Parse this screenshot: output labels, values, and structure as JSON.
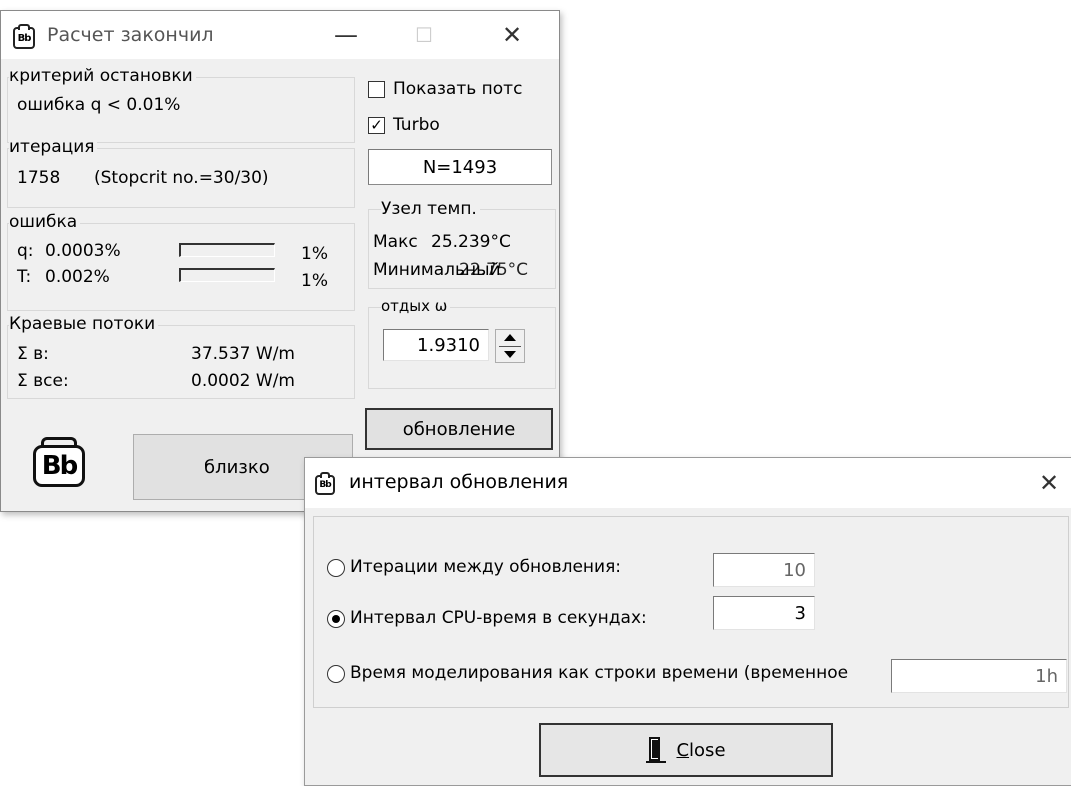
{
  "main": {
    "title": "Расчет закончил",
    "minimize_glyph": "—",
    "maximize_glyph": "☐",
    "close_glyph": "✕",
    "stop_criterion": {
      "label": "критерий остановки",
      "value": "ошибка q < 0.01%"
    },
    "iteration": {
      "label": "итерация",
      "value": "1758",
      "stopcrit": "(Stopcrit no.=30/30)"
    },
    "error": {
      "label": "ошибка",
      "q_label": "q:",
      "q_value": "0.0003%",
      "q_bar_fraction": 0.0,
      "q_max": "1%",
      "t_label": "T:",
      "t_value": "0.002%",
      "t_bar_fraction": 0.0,
      "t_max": "1%"
    },
    "boundary": {
      "label": "Краевые потоки",
      "in_label": "Σ в:",
      "in_value": "37.537 W/m",
      "all_label": "Σ все:",
      "all_value": "0.0002 W/m"
    },
    "show_flows": {
      "label": "Показать потс",
      "checked": false
    },
    "turbo": {
      "label": "Turbo",
      "checked": true,
      "check_glyph": "✓"
    },
    "n_value": "N=1493",
    "node_temp": {
      "label": "Узел темп.",
      "max_label": "Макс",
      "max_value": "25.239°C",
      "min_text": "Минимальный",
      "min_value_overlap": "22.75°C"
    },
    "relax": {
      "label": "отдых ω",
      "value": "1.9310"
    },
    "refresh_button": "обновление",
    "close_button": "близко",
    "logo_text": "Bb"
  },
  "dialog": {
    "title": "интервал обновления",
    "close_glyph": "✕",
    "options": [
      {
        "label": "Итерации между обновления:",
        "value": "10",
        "selected": false
      },
      {
        "label": "Интервал CPU-время в секундах:",
        "value": "3",
        "selected": true
      },
      {
        "label": "Время моделирования как строки времени (временное",
        "value": "1h",
        "selected": false
      }
    ],
    "close_button": "Close",
    "close_button_mnemonic": "C"
  }
}
